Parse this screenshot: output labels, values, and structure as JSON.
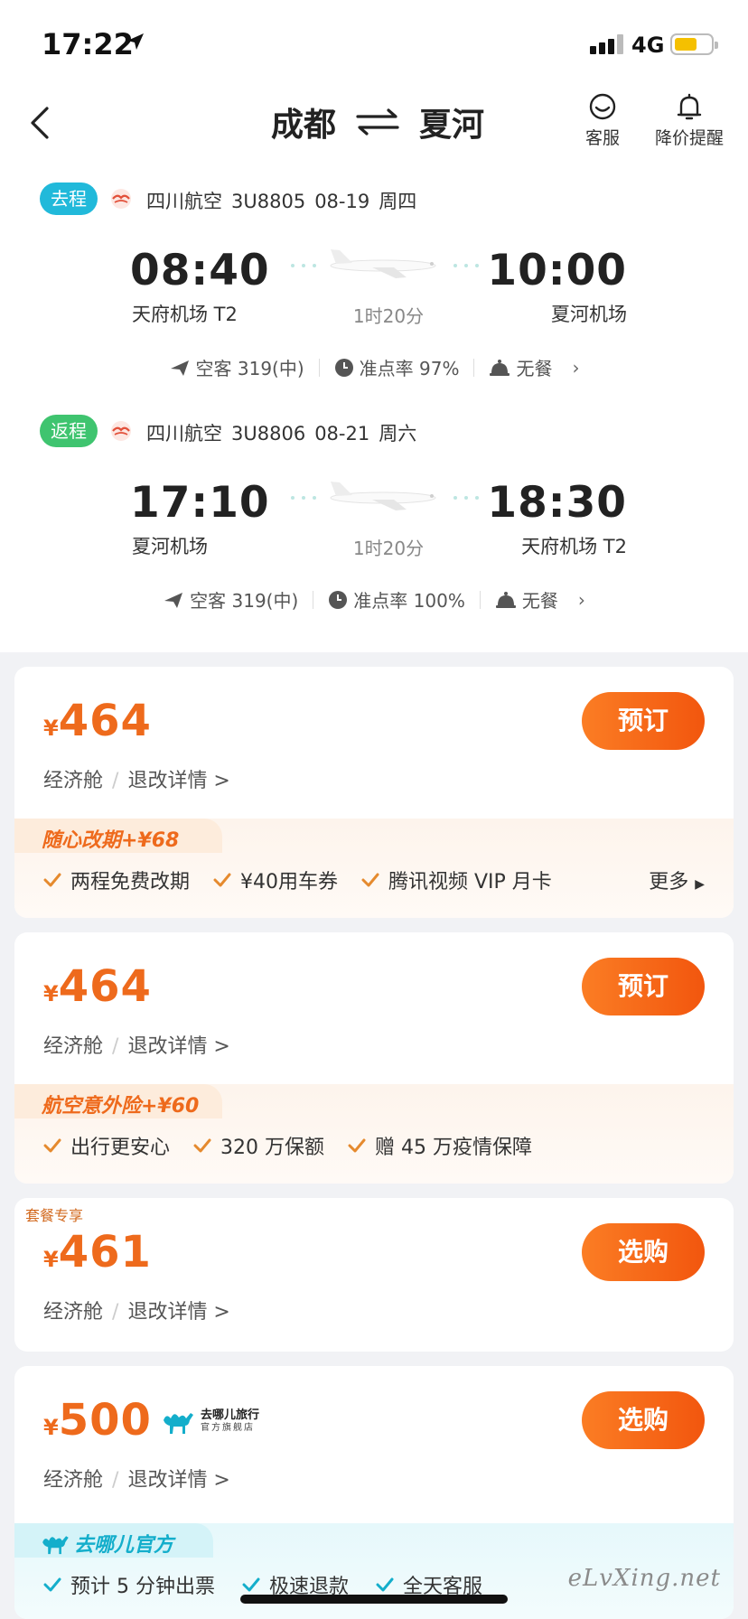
{
  "status": {
    "time": "17:22",
    "network": "4G"
  },
  "header": {
    "origin": "成都",
    "destination": "夏河",
    "service_label": "客服",
    "alert_label": "降价提醒"
  },
  "outbound": {
    "badge": "去程",
    "airline": "四川航空",
    "flight_no": "3U8805",
    "date": "08-19",
    "weekday": "周四",
    "dep_time": "08:40",
    "dep_airport": "天府机场 T2",
    "arr_time": "10:00",
    "arr_airport": "夏河机场",
    "duration": "1时20分",
    "aircraft": "空客 319(中)",
    "ontime": "准点率 97%",
    "meal": "无餐"
  },
  "inbound": {
    "badge": "返程",
    "airline": "四川航空",
    "flight_no": "3U8806",
    "date": "08-21",
    "weekday": "周六",
    "dep_time": "17:10",
    "dep_airport": "夏河机场",
    "arr_time": "18:30",
    "arr_airport": "天府机场 T2",
    "duration": "1时20分",
    "aircraft": "空客 319(中)",
    "ontime": "准点率 100%",
    "meal": "无餐"
  },
  "colors": {
    "outbound_badge": "#21b9da",
    "inbound_badge": "#3fc46f",
    "price": "#ee6a1c",
    "qunar": "#14aecb"
  },
  "offers": [
    {
      "currency": "¥",
      "price": "464",
      "cabin": "经济舱",
      "details": "退改详情 >",
      "button": "预订",
      "perk_title": "随心改期+¥68",
      "perks": [
        "两程免费改期",
        "¥40用车券",
        "腾讯视频 VIP 月卡"
      ],
      "more": "更多"
    },
    {
      "currency": "¥",
      "price": "464",
      "cabin": "经济舱",
      "details": "退改详情 >",
      "button": "预订",
      "perk_title": "航空意外险+¥60",
      "perks": [
        "出行更安心",
        "320 万保额",
        "赠 45 万疫情保障"
      ]
    },
    {
      "tag": "套餐专享",
      "currency": "¥",
      "price": "461",
      "cabin": "经济舱",
      "details": "退改详情 >",
      "button": "选购"
    },
    {
      "currency": "¥",
      "price": "500",
      "cabin": "经济舱",
      "details": "退改详情 >",
      "button": "选购",
      "vendor_line1": "去哪儿旅行",
      "vendor_line2": "官方旗舰店",
      "perk_title": "去哪儿官方",
      "perks": [
        "预计 5 分钟出票",
        "极速退款",
        "全天客服"
      ]
    }
  ],
  "watermark": "eLvXing.net"
}
